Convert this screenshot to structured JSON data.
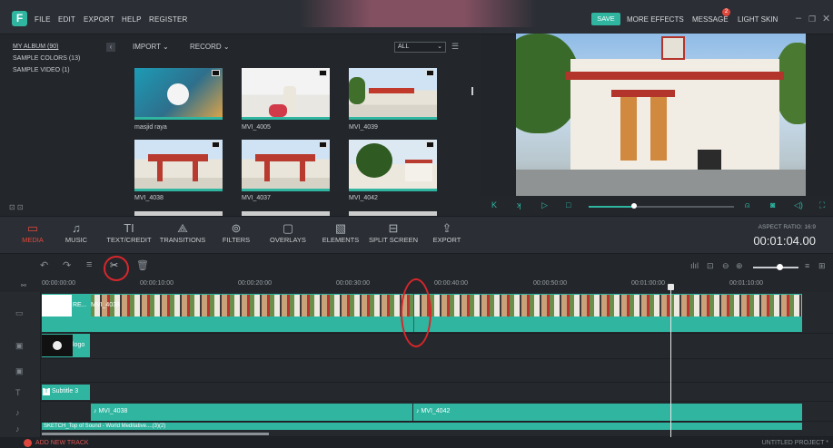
{
  "app": {
    "menu": [
      "FILE",
      "EDIT",
      "EXPORT",
      "HELP",
      "REGISTER"
    ],
    "top_right": {
      "save": "SAVE",
      "more_effects": "MORE EFFECTS",
      "message": "MESSAGE",
      "message_count": "2",
      "light_skin": "LIGHT SKIN"
    }
  },
  "library": {
    "items": [
      "MY ALBUM (90)",
      "SAMPLE COLORS (13)",
      "SAMPLE VIDEO (1)"
    ],
    "toolbar": {
      "import": "IMPORT",
      "record": "RECORD",
      "filter": "ALL"
    }
  },
  "media": [
    {
      "name": "masjid raya"
    },
    {
      "name": "MVI_4005"
    },
    {
      "name": "MVI_4039"
    },
    {
      "name": "MVI_4038"
    },
    {
      "name": "MVI_4037"
    },
    {
      "name": "MVI_4042"
    }
  ],
  "tools": [
    {
      "label": "MEDIA",
      "icon": "folder-icon"
    },
    {
      "label": "MUSIC",
      "icon": "music-icon"
    },
    {
      "label": "TEXT/CREDIT",
      "icon": "text-icon"
    },
    {
      "label": "TRANSITIONS",
      "icon": "transitions-icon"
    },
    {
      "label": "FILTERS",
      "icon": "filters-icon"
    },
    {
      "label": "OVERLAYS",
      "icon": "overlays-icon"
    },
    {
      "label": "ELEMENTS",
      "icon": "elements-icon"
    },
    {
      "label": "SPLIT SCREEN",
      "icon": "split-screen-icon"
    },
    {
      "label": "EXPORT",
      "icon": "export-icon"
    }
  ],
  "preview": {
    "aspect_ratio": "ASPECT RATIO: 16:9",
    "timecode": "00:01:04.00"
  },
  "timeline": {
    "ticks": [
      "00:00:00:00",
      "00:00:10:00",
      "00:00:20:00",
      "00:00:30:00",
      "00:00:40:00",
      "00:00:50:00",
      "00:01:00:00",
      "00:01:10:00"
    ],
    "video_clips": [
      "RE...",
      "MVI_4038"
    ],
    "pip_clip": "logo",
    "subtitle": "Subtitle 3",
    "audio_clips": [
      "MVI_4038",
      "MVI_4042"
    ],
    "bottom_clip": "SKETCH_Top of Sound - World Meditative....(3)(2)"
  },
  "footer": {
    "add_track": "ADD NEW TRACK",
    "project": "UNTITLED PROJECT *"
  },
  "colors": {
    "accent": "#2fb5a0",
    "active": "#e0473c",
    "annotation": "#d8262b"
  }
}
